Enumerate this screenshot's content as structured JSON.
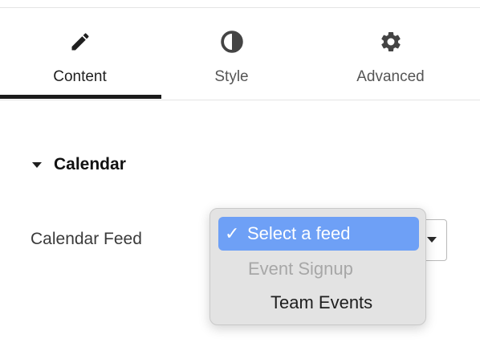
{
  "tabs": [
    {
      "label": "Content",
      "icon": "pencil-icon",
      "active": true
    },
    {
      "label": "Style",
      "icon": "contrast-icon",
      "active": false
    },
    {
      "label": "Advanced",
      "icon": "gear-icon",
      "active": false
    }
  ],
  "section": {
    "title": "Calendar"
  },
  "field": {
    "label": "Calendar Feed"
  },
  "dropdown": {
    "options": [
      {
        "label": "Select a feed",
        "state": "selected",
        "check": "✓"
      },
      {
        "label": "Event Signup",
        "state": "disabled"
      },
      {
        "label": "Team Events",
        "state": "normal"
      }
    ]
  },
  "colors": {
    "accent": "#6ea0f6",
    "active_underline": "#1b1b1b",
    "menu_background": "#e3e3e3"
  }
}
